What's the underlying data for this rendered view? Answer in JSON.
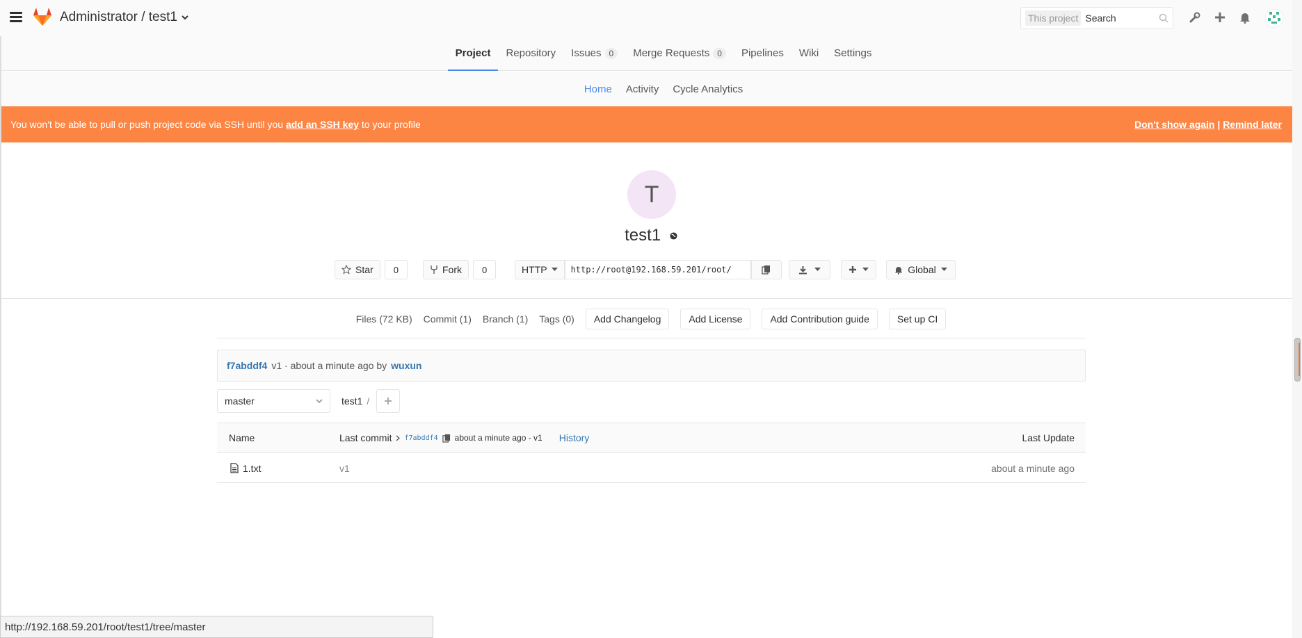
{
  "header": {
    "title": "Administrator / test1",
    "search_scope": "This project",
    "search_placeholder": "Search"
  },
  "project_nav": {
    "items": [
      {
        "label": "Project",
        "active": true
      },
      {
        "label": "Repository"
      },
      {
        "label": "Issues",
        "badge": "0"
      },
      {
        "label": "Merge Requests",
        "badge": "0"
      },
      {
        "label": "Pipelines"
      },
      {
        "label": "Wiki"
      },
      {
        "label": "Settings"
      }
    ]
  },
  "sub_nav": {
    "items": [
      "Home",
      "Activity",
      "Cycle Analytics"
    ]
  },
  "banner": {
    "text_before": "You won't be able to pull or push project code via SSH until you ",
    "link": "add an SSH key",
    "text_after": " to your profile",
    "dont_show": "Don't show again",
    "separator": "|",
    "remind": "Remind later"
  },
  "project": {
    "avatar_letter": "T",
    "name": "test1",
    "star_label": "Star",
    "star_count": "0",
    "fork_label": "Fork",
    "fork_count": "0",
    "protocol": "HTTP",
    "clone_url": "http://root@192.168.59.201/root/",
    "notification": "Global"
  },
  "stats": {
    "files": "Files (72 KB)",
    "commit": "Commit (1)",
    "branch": "Branch (1)",
    "tags": "Tags (0)",
    "add_changelog": "Add Changelog",
    "add_license": "Add License",
    "add_contribution": "Add Contribution guide",
    "setup_ci": "Set up CI"
  },
  "last_commit": {
    "sha": "f7abddf4",
    "message": "v1 · about a minute ago by",
    "author": "wuxun"
  },
  "tree": {
    "branch": "master",
    "path": "test1",
    "path_sep": "/",
    "col_name": "Name",
    "col_last_commit": "Last commit",
    "head_sha": "f7abddf4",
    "head_meta": "about a minute ago - v1",
    "history": "History",
    "col_last_update": "Last Update",
    "rows": [
      {
        "name": "1.txt",
        "commit": "v1",
        "updated": "about a minute ago"
      }
    ]
  },
  "statusbar": {
    "url": "http://192.168.59.201/root/test1/tree/master"
  },
  "colors": {
    "banner": "#fc8543",
    "link": "#3777b0",
    "active_tab": "#4a8bee"
  }
}
